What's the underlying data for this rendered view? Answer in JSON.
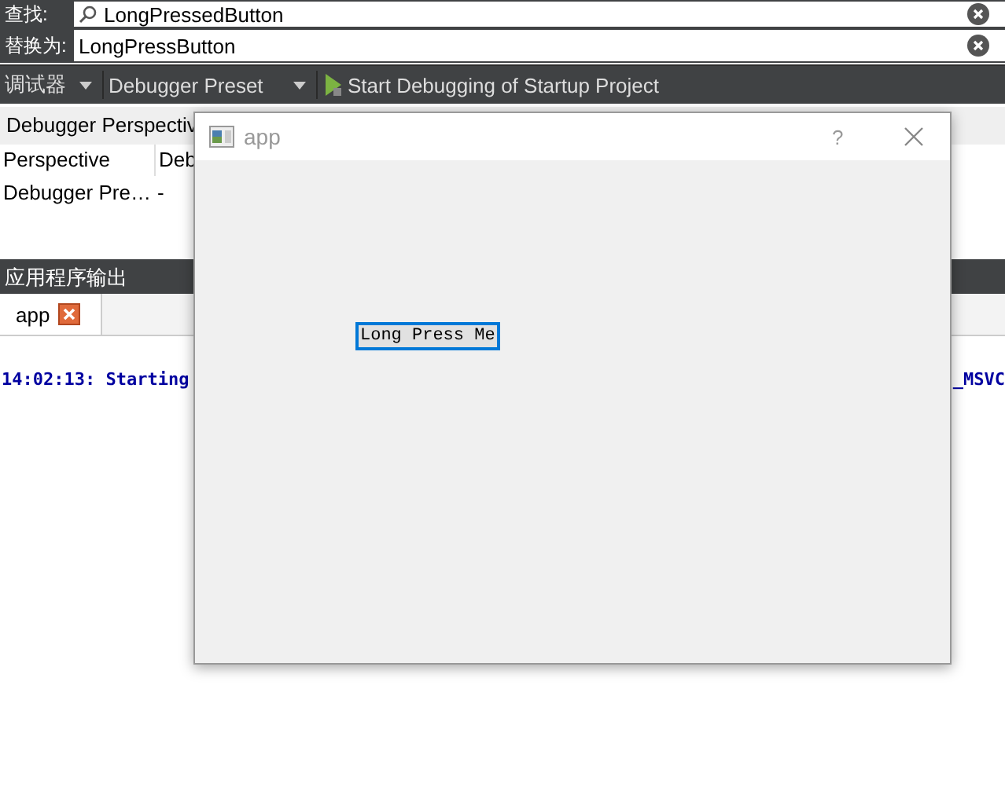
{
  "find": {
    "label": "查找:",
    "value": "LongPressedButton"
  },
  "replace": {
    "label": "替换为:",
    "value": "LongPressButton"
  },
  "toolbar": {
    "debugger_label": "调试器",
    "preset": "Debugger Preset",
    "start_button": "Start Debugging of Startup Project"
  },
  "perspective_header": "Debugger Perspectiv",
  "table": {
    "columns": [
      "Perspective",
      "Deb"
    ],
    "rows": [
      [
        "Debugger Pre…",
        "-"
      ]
    ]
  },
  "output_pane": {
    "title": "应用程序输出",
    "tabs": [
      {
        "label": "app",
        "selected": true
      }
    ],
    "lines": [
      {
        "left": "14:02:13: Starting",
        "right": "_MSVC"
      }
    ]
  },
  "dialog": {
    "title": "app",
    "help": "?",
    "button": "Long Press Me"
  }
}
